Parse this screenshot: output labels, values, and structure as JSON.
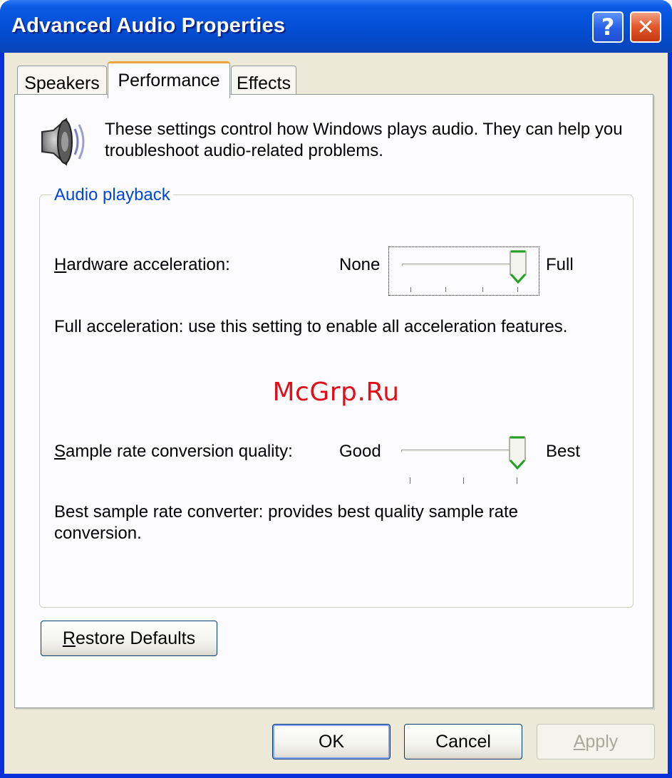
{
  "window": {
    "title": "Advanced Audio Properties",
    "help_button": "?",
    "close_button": "✕"
  },
  "tabs": [
    {
      "label": "Speakers",
      "active": false
    },
    {
      "label": "Performance",
      "active": true
    },
    {
      "label": "Effects",
      "active": false
    }
  ],
  "intro": {
    "icon": "speaker-icon",
    "text": "These settings control how Windows plays audio. They can help you troubleshoot audio-related problems."
  },
  "group": {
    "label": "Audio playback",
    "hardware_acceleration": {
      "label_mnemonic": "H",
      "label_rest": "ardware acceleration:",
      "min_label": "None",
      "max_label": "Full",
      "value_fraction": 1.0,
      "description": "Full acceleration: use this setting to enable all acceleration features."
    },
    "sample_rate": {
      "label_mnemonic": "S",
      "label_rest": "ample rate conversion quality:",
      "min_label": "Good",
      "max_label": "Best",
      "value_fraction": 1.0,
      "description": "Best sample rate converter:  provides best quality sample rate conversion."
    }
  },
  "restore_defaults": {
    "mnemonic": "R",
    "rest": "estore Defaults"
  },
  "footer": {
    "ok": "OK",
    "cancel": "Cancel",
    "apply_mnemonic": "A",
    "apply_rest": "pply"
  },
  "watermark": "McGrp.Ru",
  "colors": {
    "titlebar": "#0451d8",
    "client_bg": "#ece9d8",
    "group_label": "#0046d5",
    "active_tab_accent": "#f0a33c",
    "thumb_accent": "#21a121"
  }
}
